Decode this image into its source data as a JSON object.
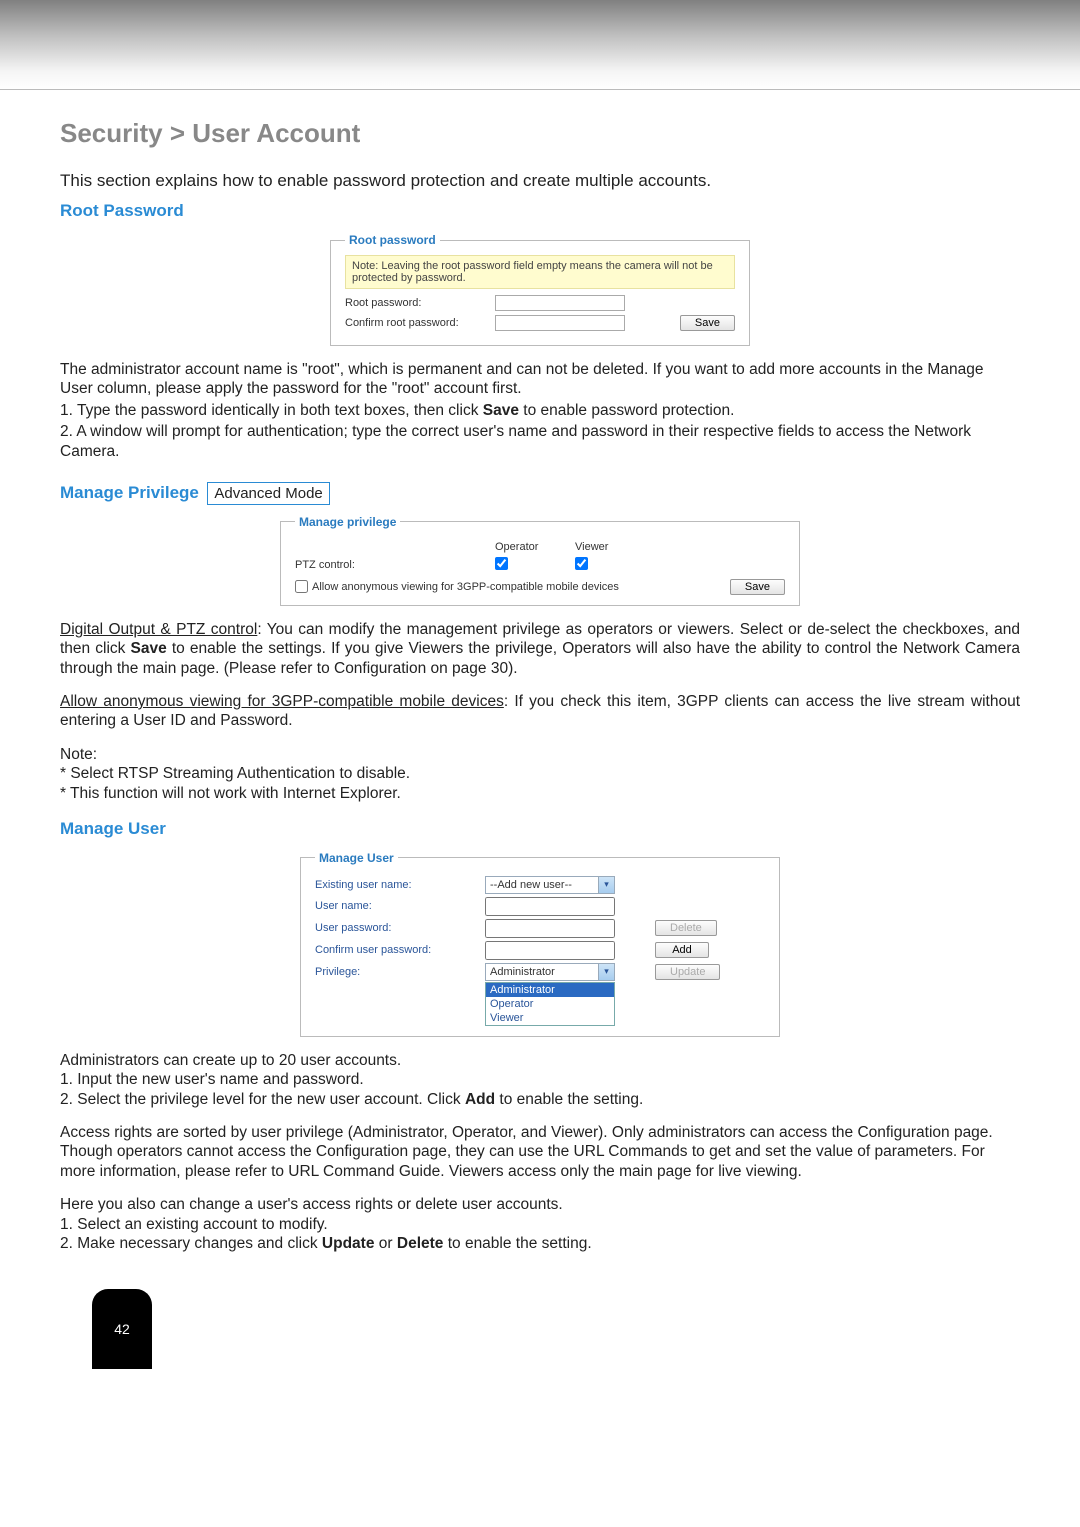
{
  "page_number": "42",
  "breadcrumb": "Security > User Account",
  "intro": "This section explains how to enable password protection and create multiple accounts.",
  "root_password": {
    "heading": "Root Password",
    "legend": "Root password",
    "note": "Note: Leaving the root password field empty means the camera will not be protected by password.",
    "label_root": "Root password:",
    "label_confirm": "Confirm root password:",
    "save": "Save"
  },
  "root_text": {
    "p1": "The administrator account name is \"root\", which is permanent and can not be deleted. If you want to add more accounts in the Manage User column, please apply the password for the \"root\" account first.",
    "li1_a": "1. Type the password identically in both text boxes, then click ",
    "li1_b": "Save",
    "li1_c": " to enable password protection.",
    "li2": "2. A window will prompt for authentication; type the correct user's name and password in their respective fields to access the Network Camera."
  },
  "manage_priv": {
    "heading": "Manage Privilege",
    "mode": "Advanced Mode",
    "legend": "Manage privilege",
    "col_operator": "Operator",
    "col_viewer": "Viewer",
    "row_ptz": "PTZ control:",
    "allow_anon": "Allow anonymous viewing for 3GPP-compatible mobile devices",
    "save": "Save"
  },
  "priv_text": {
    "p1_a": "Digital Output & PTZ control",
    "p1_b": ": You can modify the management privilege as operators or viewers. Select or de-select the checkboxes, and then click ",
    "p1_c": "Save",
    "p1_d": " to enable the settings. If you give Viewers the privilege, Operators will also have the ability to control the Network Camera through the main page. (Please refer to Configuration on page 30).",
    "p2_a": "Allow anonymous viewing for 3GPP-compatible mobile devices",
    "p2_b": ": If you check this item, 3GPP clients can access the live stream without entering a User ID and Password.",
    "note": "Note:",
    "n1": "* Select RTSP Streaming Authentication to disable.",
    "n2": "* This function will not work with Internet Explorer."
  },
  "manage_user": {
    "heading": "Manage User",
    "legend": "Manage User",
    "existing": "Existing user name:",
    "existing_value": "--Add new user--",
    "username": "User name:",
    "userpass": "User password:",
    "confirmpass": "Confirm user password:",
    "privilege": "Privilege:",
    "privilege_selected": "Administrator",
    "options": {
      "o1": "Administrator",
      "o2": "Operator",
      "o3": "Viewer"
    },
    "btn_delete": "Delete",
    "btn_add": "Add",
    "btn_update": "Update"
  },
  "user_text": {
    "p1": "Administrators can create up to 20 user accounts.",
    "li1": "1. Input the new user's name and password.",
    "li2_a": "2. Select the privilege level for the new user account. Click ",
    "li2_b": "Add",
    "li2_c": " to enable the setting.",
    "p2": "Access rights are sorted by user privilege (Administrator, Operator, and Viewer). Only administrators can access the Configuration page. Though operators cannot access the Configuration page, they can use the URL Commands to get and set the value of parameters. For more information, please refer to URL Command Guide. Viewers access only the main page for live viewing.",
    "p3": "Here you also can change a user's access rights or delete user accounts.",
    "li3": "1. Select an existing account to modify.",
    "li4_a": "2. Make necessary changes and click ",
    "li4_b": "Update",
    "li4_c": " or ",
    "li4_d": "Delete",
    "li4_e": " to enable the setting."
  }
}
